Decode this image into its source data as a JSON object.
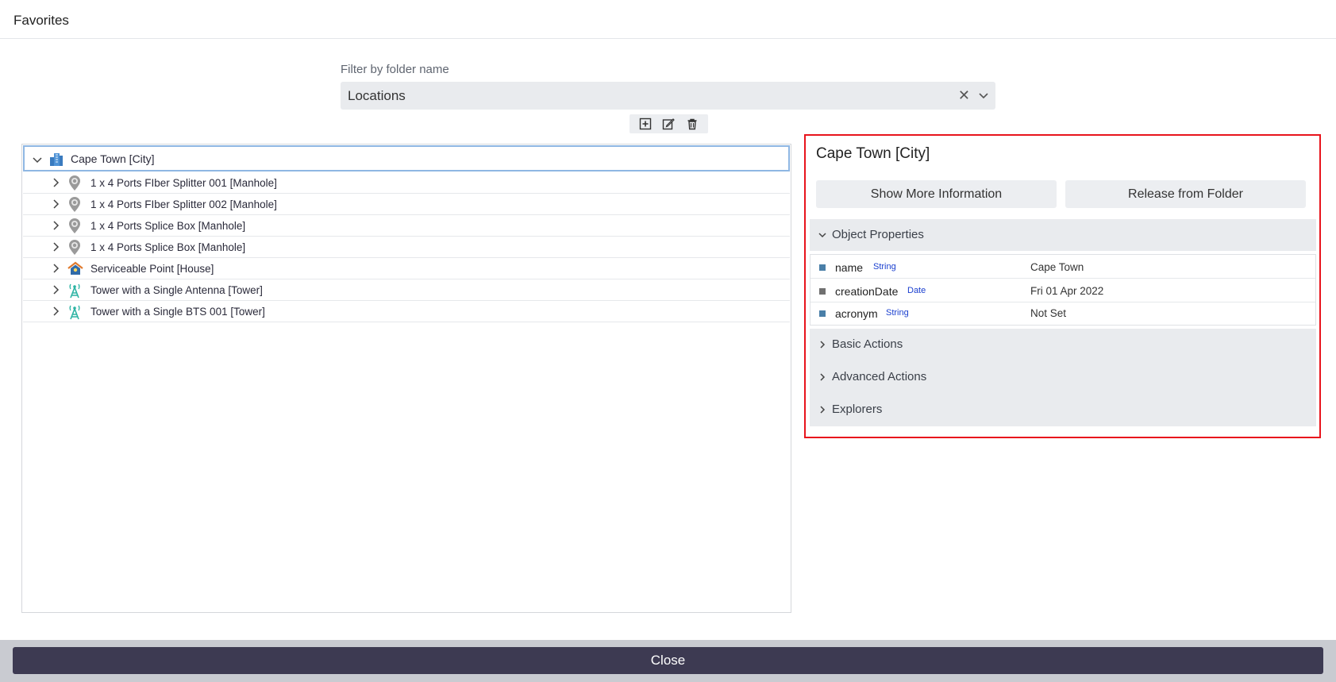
{
  "header": {
    "title": "Favorites"
  },
  "filter": {
    "label": "Filter by folder name",
    "value": "Locations"
  },
  "toolbar": {
    "add_icon": "add-square-icon",
    "edit_icon": "edit-icon",
    "delete_icon": "trash-icon"
  },
  "tree": {
    "root": {
      "label": "Cape Town [City]",
      "icon": "city-icon"
    },
    "children": [
      {
        "label": "1 x 4 Ports FIber Splitter 001 [Manhole]",
        "icon": "manhole-pin-icon"
      },
      {
        "label": "1 x 4 Ports FIber Splitter 002 [Manhole]",
        "icon": "manhole-pin-icon"
      },
      {
        "label": "1 x 4 Ports Splice Box [Manhole]",
        "icon": "manhole-pin-icon"
      },
      {
        "label": "1 x 4 Ports Splice Box [Manhole]",
        "icon": "manhole-pin-icon"
      },
      {
        "label": "Serviceable Point [House]",
        "icon": "house-icon"
      },
      {
        "label": "Tower with a Single Antenna [Tower]",
        "icon": "tower-icon"
      },
      {
        "label": "Tower with a Single BTS 001 [Tower]",
        "icon": "tower-icon"
      }
    ]
  },
  "detail": {
    "title": "Cape Town [City]",
    "show_more_label": "Show More Information",
    "release_label": "Release from Folder",
    "object_properties_label": "Object Properties",
    "properties": [
      {
        "name": "name",
        "type": "String",
        "value": "Cape Town",
        "color": "#4a7fa8"
      },
      {
        "name": "creationDate",
        "type": "Date",
        "value": "Fri 01 Apr 2022",
        "color": "#707070"
      },
      {
        "name": "acronym",
        "type": "String",
        "value": "Not Set",
        "color": "#4a7fa8"
      }
    ],
    "sections": [
      {
        "label": "Basic Actions"
      },
      {
        "label": "Advanced Actions"
      },
      {
        "label": "Explorers"
      }
    ]
  },
  "footer": {
    "close_label": "Close"
  },
  "colors": {
    "highlight_border": "#e8141c",
    "footer_button": "#3d3a52",
    "selected_border": "#8fb7e3"
  }
}
